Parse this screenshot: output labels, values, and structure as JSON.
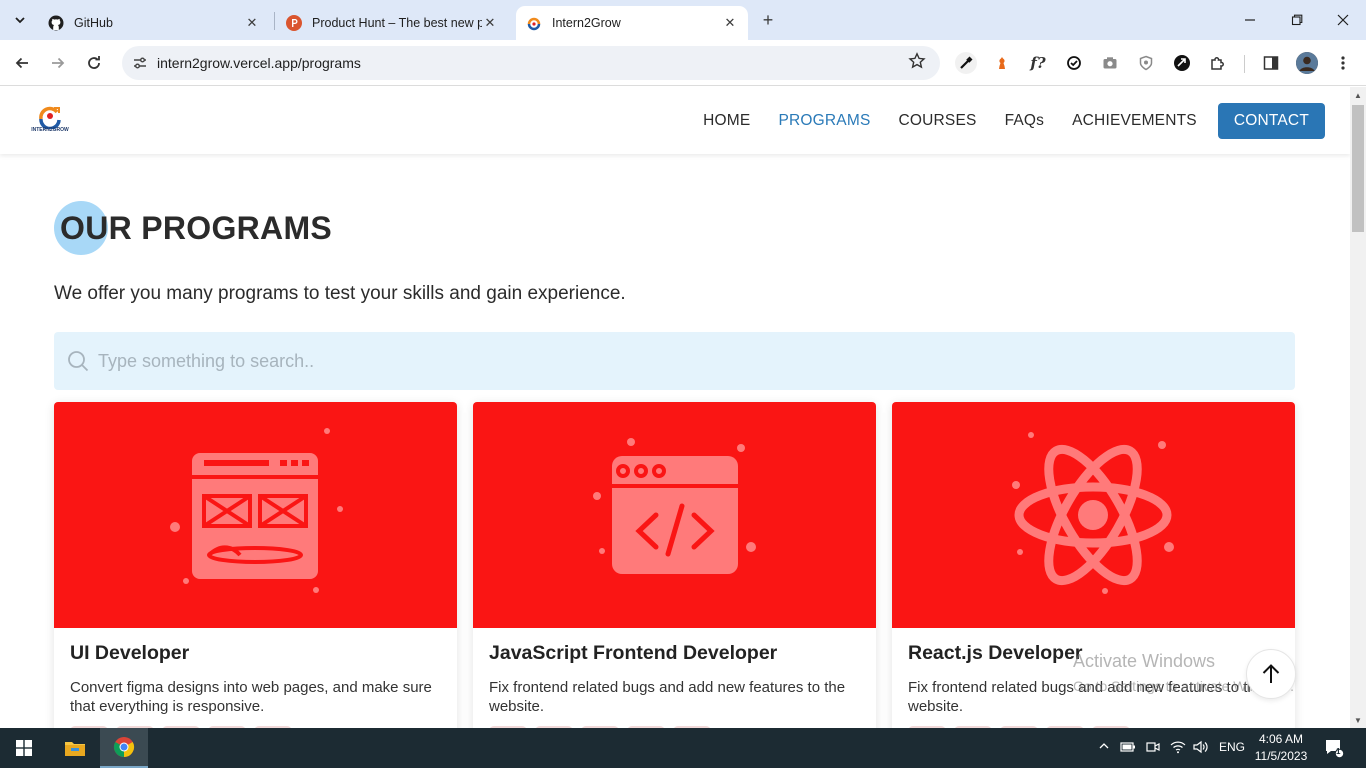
{
  "browser": {
    "tabs": [
      {
        "title": "GitHub",
        "icon": "github-icon"
      },
      {
        "title": "Product Hunt – The best new products in tech.",
        "icon": "producthunt-icon"
      },
      {
        "title": "Intern2Grow",
        "icon": "intern2grow-icon"
      }
    ],
    "close_glyph": "✕",
    "new_tab_glyph": "+",
    "url": "intern2grow.vercel.app/programs"
  },
  "site": {
    "logo_text": "INTERN2GROW",
    "nav": [
      {
        "label": "HOME"
      },
      {
        "label": "PROGRAMS"
      },
      {
        "label": "COURSES"
      },
      {
        "label": "FAQs"
      },
      {
        "label": "ACHIEVEMENTS"
      },
      {
        "label": "CONTACT"
      }
    ],
    "active_nav": "PROGRAMS",
    "accent_color": "#2a76b5",
    "card_color": "#fa1514"
  },
  "main": {
    "title": "OUR PROGRAMS",
    "subtitle": "We offer you many programs to test your skills and gain experience.",
    "search_placeholder": "Type something to search..",
    "cards": [
      {
        "title": "UI Developer",
        "description": "Convert figma designs into web pages, and make sure that everything is responsive.",
        "icon": "ui-design-icon"
      },
      {
        "title": "JavaScript Frontend Developer",
        "description": "Fix frontend related bugs and add new features to the website.",
        "icon": "code-window-icon"
      },
      {
        "title": "React.js Developer",
        "description": "Fix frontend related bugs and add new features to the website.",
        "icon": "react-icon"
      }
    ]
  },
  "overlay": {
    "watermark_title": "Activate Windows",
    "watermark_sub": "Go to Settings to activate Windows."
  },
  "taskbar": {
    "language": "ENG",
    "time": "4:06 AM",
    "date": "11/5/2023",
    "notification_count": "1"
  }
}
